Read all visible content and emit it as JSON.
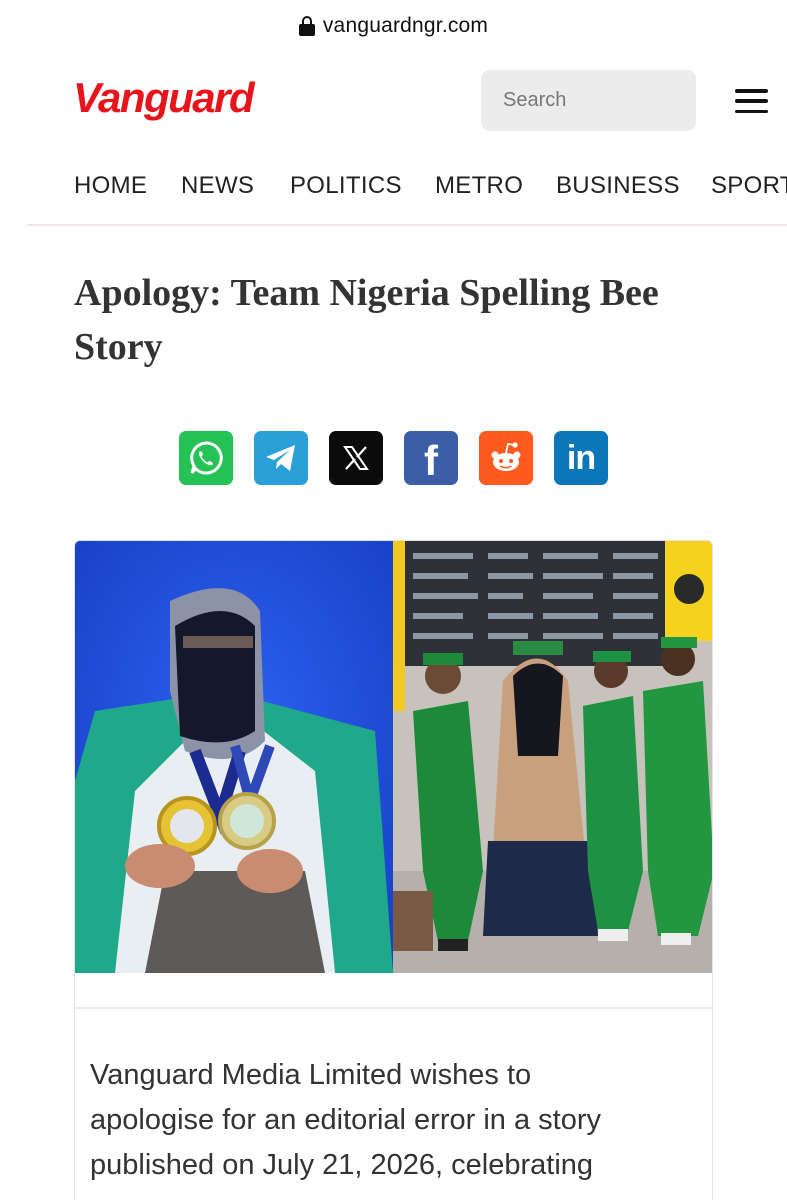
{
  "browser": {
    "url": "vanguardngr.com",
    "lock_icon": "lock-icon"
  },
  "header": {
    "logo_text": "Vanguard",
    "search_placeholder": "Search",
    "search_icon": "search-icon",
    "menu_icon": "hamburger-menu-icon"
  },
  "nav": {
    "items": [
      "HOME",
      "NEWS",
      "POLITICS",
      "METRO",
      "BUSINESS",
      "SPORT"
    ]
  },
  "article": {
    "title": "Apology: Team Nigeria Spelling Bee Story",
    "share": [
      {
        "name": "whatsapp-icon",
        "color": "#25c256"
      },
      {
        "name": "telegram-icon",
        "color": "#2a9fd8"
      },
      {
        "name": "x-icon",
        "color": "#0b0b0b"
      },
      {
        "name": "facebook-icon",
        "color": "#3b5ea6"
      },
      {
        "name": "reddit-icon",
        "color": "#ff5a1f"
      },
      {
        "name": "linkedin-icon",
        "color": "#0b76b8"
      }
    ],
    "body_line1": "Vanguard Media Limited wishes to",
    "body_line2": "apologise for an editorial error in a story",
    "body_line3": "published on July 21, 2026, celebrating"
  },
  "colors": {
    "brand_red": "#e8141c",
    "search_button": "#f60a12"
  }
}
